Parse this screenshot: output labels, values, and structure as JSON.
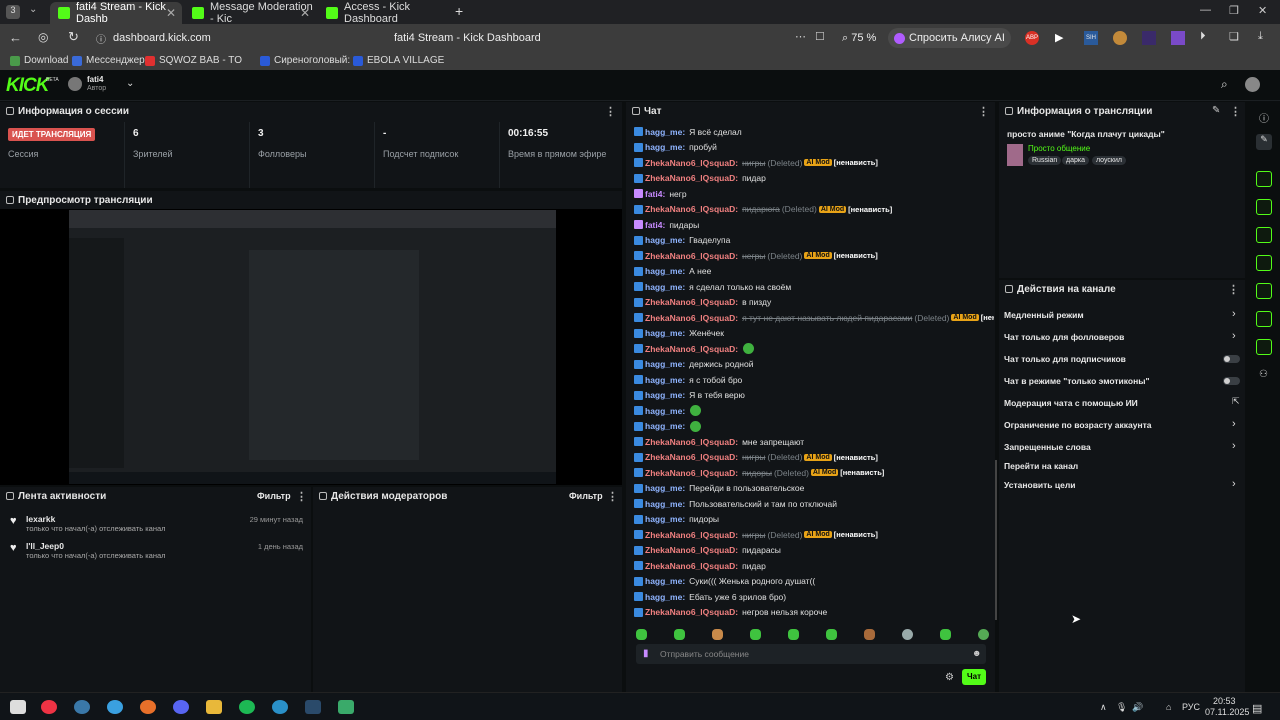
{
  "browser": {
    "tabs": [
      {
        "title": "fati4 Stream - Kick Dashb"
      },
      {
        "title": "Message Moderation - Kic"
      },
      {
        "title": "Access - Kick Dashboard"
      }
    ],
    "url": "dashboard.kick.com",
    "page_title": "fati4 Stream - Kick Dashboard",
    "zoom": "75 %",
    "alice": "Спросить Алису AI",
    "bookmarks": [
      "Download",
      "Мессенджер",
      "SQWOZ BAB - TO",
      "Сиреноголовый:",
      "EBOLA VILLAGE"
    ]
  },
  "header": {
    "logo": "KICK",
    "logo_badge": "BETA",
    "username": "fati4",
    "role": "Автор"
  },
  "session": {
    "title": "Информация о сессии",
    "live_label": "ИДЕТ ТРАНСЛЯЦИЯ",
    "session_label": "Сессия",
    "stats": [
      {
        "value": "6",
        "label": "Зрителей"
      },
      {
        "value": "3",
        "label": "Фолловеры"
      },
      {
        "value": "-",
        "label": "Подсчет подписок"
      },
      {
        "value": "00:16:55",
        "label": "Время в прямом эфире"
      }
    ]
  },
  "preview": {
    "title": "Предпросмотр трансляции"
  },
  "activity": {
    "title": "Лента активности",
    "filter": "Фильтр",
    "items": [
      {
        "user": "lexarkk",
        "text": "только что начал(-а) отслеживать канал",
        "time": "29 минут назад"
      },
      {
        "user": "l'll_Jeep0",
        "text": "только что начал(-а) отслеживать канал",
        "time": "1 день назад"
      }
    ]
  },
  "modactions": {
    "title": "Действия модераторов",
    "filter": "Фильтр"
  },
  "chat": {
    "title": "Чат",
    "placeholder": "Отправить сообщение",
    "send": "Чат",
    "messages": [
      {
        "user": "hagg_me",
        "color": "#8fb4ff",
        "text": "Я всё сделал"
      },
      {
        "user": "hagg_me",
        "color": "#8fb4ff",
        "text": "пробуй"
      },
      {
        "user": "ZhekaNano6_lQsquaD",
        "color": "#f08080",
        "deleted_text": "нигры",
        "deleted_note": "(Deleted)",
        "ai": "AI Mod",
        "tag": "[ненависть]"
      },
      {
        "user": "ZhekaNano6_lQsquaD",
        "color": "#f08080",
        "text": "пидар"
      },
      {
        "user": "fati4",
        "color": "#c78aff",
        "text": "негр"
      },
      {
        "user": "ZhekaNano6_lQsquaD",
        "color": "#f08080",
        "deleted_text": "пидарюга",
        "deleted_note": "(Deleted)",
        "ai": "AI Mod",
        "tag": "[ненависть]"
      },
      {
        "user": "fati4",
        "color": "#c78aff",
        "text": "пидары"
      },
      {
        "user": "hagg_me",
        "color": "#8fb4ff",
        "text": "Гваделупа"
      },
      {
        "user": "ZhekaNano6_lQsquaD",
        "color": "#f08080",
        "deleted_text": "негры",
        "deleted_note": "(Deleted)",
        "ai": "AI Mod",
        "tag": "[ненависть]"
      },
      {
        "user": "hagg_me",
        "color": "#8fb4ff",
        "text": "А нее"
      },
      {
        "user": "hagg_me",
        "color": "#8fb4ff",
        "text": "я сделал только на своём"
      },
      {
        "user": "ZhekaNano6_lQsquaD",
        "color": "#f08080",
        "text": "в пизду"
      },
      {
        "user": "ZhekaNano6_lQsquaD",
        "color": "#f08080",
        "deleted_text": "я тут не дают называть людей пидарасами",
        "deleted_note": "(Deleted)",
        "ai": "AI Mod",
        "tag": "[ненависть]"
      },
      {
        "user": "hagg_me",
        "color": "#8fb4ff",
        "text": "Женёчек"
      },
      {
        "user": "ZhekaNano6_lQsquaD",
        "color": "#f08080",
        "text": "",
        "emote": true
      },
      {
        "user": "hagg_me",
        "color": "#8fb4ff",
        "text": "держись родной"
      },
      {
        "user": "hagg_me",
        "color": "#8fb4ff",
        "text": "я с тобой бро"
      },
      {
        "user": "hagg_me",
        "color": "#8fb4ff",
        "text": "Я в тебя верю"
      },
      {
        "user": "hagg_me",
        "color": "#8fb4ff",
        "text": "",
        "emote": true
      },
      {
        "user": "hagg_me",
        "color": "#8fb4ff",
        "text": "",
        "emote": true
      },
      {
        "user": "ZhekaNano6_lQsquaD",
        "color": "#f08080",
        "text": "мне запрещают"
      },
      {
        "user": "ZhekaNano6_lQsquaD",
        "color": "#f08080",
        "deleted_text": "нигры",
        "deleted_note": "(Deleted)",
        "ai": "AI Mod",
        "tag": "[ненависть]"
      },
      {
        "user": "ZhekaNano6_lQsquaD",
        "color": "#f08080",
        "deleted_text": "пидоры",
        "deleted_note": "(Deleted)",
        "ai": "AI Mod",
        "tag": "[ненависть]"
      },
      {
        "user": "hagg_me",
        "color": "#8fb4ff",
        "text": "Перейди в пользовательское"
      },
      {
        "user": "hagg_me",
        "color": "#8fb4ff",
        "text": "Пользовательский и там по отключай"
      },
      {
        "user": "hagg_me",
        "color": "#8fb4ff",
        "text": "пидоры"
      },
      {
        "user": "ZhekaNano6_lQsquaD",
        "color": "#f08080",
        "deleted_text": "нигры",
        "deleted_note": "(Deleted)",
        "ai": "AI Mod",
        "tag": "[ненависть]"
      },
      {
        "user": "ZhekaNano6_lQsquaD",
        "color": "#f08080",
        "text": "пидарасы"
      },
      {
        "user": "ZhekaNano6_lQsquaD",
        "color": "#f08080",
        "text": "пидар"
      },
      {
        "user": "hagg_me",
        "color": "#8fb4ff",
        "text": "Суки((( Женька родного душат(("
      },
      {
        "user": "hagg_me",
        "color": "#8fb4ff",
        "text": "Ебать уже 6 зрилов бро)"
      },
      {
        "user": "ZhekaNano6_lQsquaD",
        "color": "#f08080",
        "text": "негров нельзя короче"
      }
    ]
  },
  "streaminfo": {
    "title": "Информация о трансляции",
    "stream_title": "просто аниме \"Когда плачут цикады\"",
    "category": "Просто общение",
    "tags": [
      "Russian",
      "дарка",
      "лоускил"
    ]
  },
  "channel_actions": {
    "title": "Действия на канале",
    "items": [
      {
        "label": "Медленный режим",
        "control": "chevron"
      },
      {
        "label": "Чат только для фолловеров",
        "control": "chevron"
      },
      {
        "label": "Чат только для подписчиков",
        "control": "toggle"
      },
      {
        "label": "Чат в режиме \"только эмотиконы\"",
        "control": "toggle"
      },
      {
        "label": "Модерация чата с помощью ИИ",
        "control": "external"
      },
      {
        "label": "Ограничение по возрасту аккаунта",
        "control": "chevron"
      },
      {
        "label": "Запрещенные слова",
        "control": "chevron"
      },
      {
        "label": "Перейти на канал",
        "control": "none"
      },
      {
        "label": "Установить цели",
        "control": "chevron"
      }
    ]
  },
  "taskbar": {
    "lang": "РУС",
    "time": "20:53",
    "date": "07.11.2025"
  }
}
